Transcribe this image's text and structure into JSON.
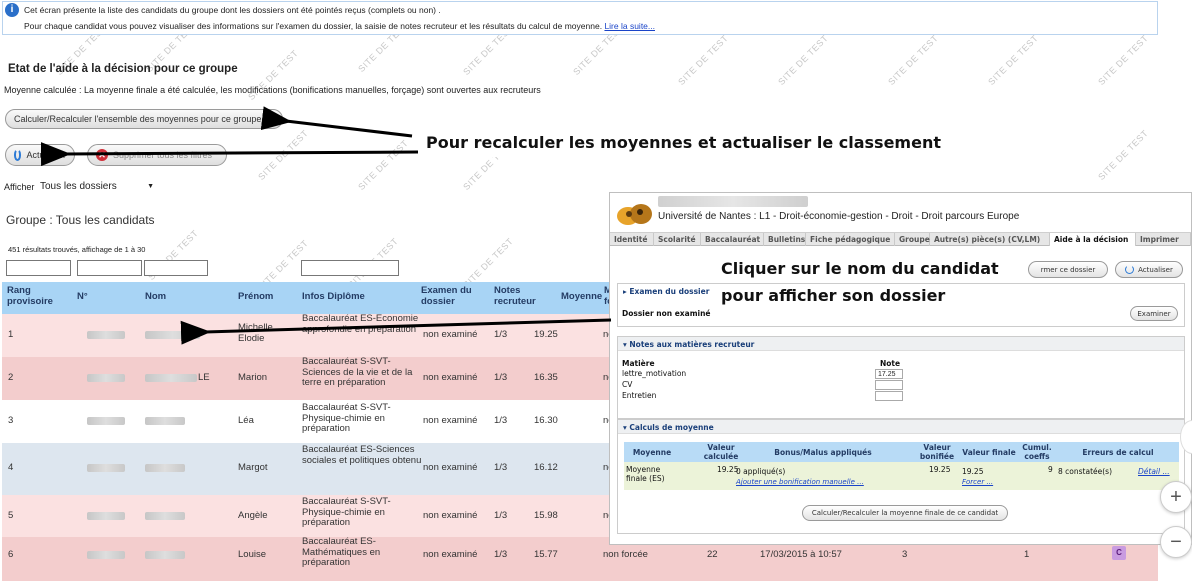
{
  "info": {
    "line1": "Cet écran présente la liste des candidats du groupe dont les dossiers ont été pointés reçus (complets ou non) .",
    "line2": "Pour chaque candidat vous pouvez visualiser des informations sur l'examen du dossier, la saisie de notes recruteur et les résultats du calcul de moyenne.",
    "link": "Lire la suite..."
  },
  "watermark": "SITE DE TEST",
  "etat": {
    "title": "Etat de l'aide à la décision pour ce groupe",
    "desc": "Moyenne calculée : La moyenne finale a été calculée, les modifications (bonifications manuelles, forçage) sont ouvertes aux recruteurs"
  },
  "buttons": {
    "recalc": "Calculer/Recalculer l'ensemble des moyennes pour ce groupe",
    "actualiser": "Actualiser",
    "supprimer": "Supprimer tous les filtres"
  },
  "afficher": {
    "label": "Afficher",
    "value": "Tous les dossiers"
  },
  "group_title": "Groupe : Tous les candidats",
  "results": "451 résultats trouvés, affichage de 1 à 30",
  "table": {
    "headers": {
      "rang": "Rang provisoire",
      "num": "N°",
      "nom": "Nom",
      "prenom": "Prénom",
      "infos": "Infos Diplôme",
      "examen": "Examen du dossier",
      "notes": "Notes recruteur",
      "moyenne": "Moyenne",
      "mf": "Mo fo"
    },
    "rows": [
      {
        "rang": "1",
        "nom_suffix": "",
        "prenom": "Michelle Elodie",
        "infos": "Baccalauréat ES-Economie approfondie en préparation",
        "examen": "non examiné",
        "notes": "1/3",
        "moyenne": "19.25",
        "statut": "no"
      },
      {
        "rang": "2",
        "nom_suffix": "LE",
        "prenom": "Marion",
        "infos": "Baccalauréat S-SVT-Sciences de la vie et de la terre en préparation",
        "examen": "non examiné",
        "notes": "1/3",
        "moyenne": "16.35",
        "statut": "no"
      },
      {
        "rang": "3",
        "nom_suffix": "",
        "prenom": "Léa",
        "infos": "Baccalauréat S-SVT-Physique-chimie en préparation",
        "examen": "non examiné",
        "notes": "1/3",
        "moyenne": "16.30",
        "statut": "no"
      },
      {
        "rang": "4",
        "nom_suffix": "",
        "prenom": "Margot",
        "infos": "Baccalauréat ES-Sciences sociales et politiques obtenu",
        "examen": "non examiné",
        "notes": "1/3",
        "moyenne": "16.12",
        "statut": "no"
      },
      {
        "rang": "5",
        "nom_suffix": "",
        "prenom": "Angèle",
        "infos": "Baccalauréat S-SVT-Physique-chimie en préparation",
        "examen": "non examiné",
        "notes": "1/3",
        "moyenne": "15.98",
        "statut": "no"
      },
      {
        "rang": "6",
        "nom_suffix": "",
        "prenom": "Louise",
        "infos": "Baccalauréat ES-Mathématiques en préparation",
        "examen": "non examiné",
        "notes": "1/3",
        "moyenne": "15.77",
        "statut": "non forcée",
        "extra1": "22",
        "date": "17/03/2015 à 10:57",
        "extra2": "3",
        "extra3": "1",
        "badge": "C"
      }
    ]
  },
  "callouts": {
    "recalc": "Pour recalculer les moyennes et actualiser le classement",
    "nom_line1": "Cliquer sur le nom du candidat",
    "nom_line2": "pour afficher son dossier"
  },
  "panel": {
    "univ": "Université de Nantes : L1 - Droit-économie-gestion - Droit - Droit parcours Europe",
    "tabs": [
      "Identité",
      "Scolarité",
      "Baccalauréat",
      "Bulletins",
      "Fiche pédagogique",
      "Groupe",
      "Autre(s) pièce(s) (CV,LM)",
      "Aide à la décision",
      "Imprimer"
    ],
    "btn_fermer": "rmer ce dossier",
    "btn_actualiser": "Actualiser",
    "examen": {
      "title": "Examen du dossier",
      "status": "Dossier non examiné",
      "button": "Examiner"
    },
    "notes": {
      "title": "Notes aux matières recruteur",
      "col_matiere": "Matière",
      "col_note": "Note",
      "rows": [
        {
          "matiere": "lettre_motivation",
          "note": "17.25"
        },
        {
          "matiere": "CV",
          "note": ""
        },
        {
          "matiere": "Entretien",
          "note": ""
        }
      ]
    },
    "calculs": {
      "title": "Calculs de moyenne",
      "headers": [
        "Moyenne",
        "Valeur calculée",
        "Bonus/Malus appliqués",
        "Valeur bonifiée",
        "Valeur finale",
        "Cumul. coeffs",
        "Erreurs de calcul"
      ],
      "row": {
        "moyenne": "Moyenne finale (ES)",
        "calculee": "19.25",
        "bonus": "0 appliqué(s)",
        "bonus_link": "Ajouter une bonification manuelle ...",
        "bonifiee": "19.25",
        "finale": "19.25",
        "forcer": "Forcer ...",
        "coeffs": "9",
        "erreurs": "8 constatée(s)",
        "detail": "Détail ..."
      },
      "button": "Calculer/Recalculer la moyenne finale de ce candidat"
    }
  },
  "zoom": {
    "plus": "+",
    "minus": "−"
  }
}
